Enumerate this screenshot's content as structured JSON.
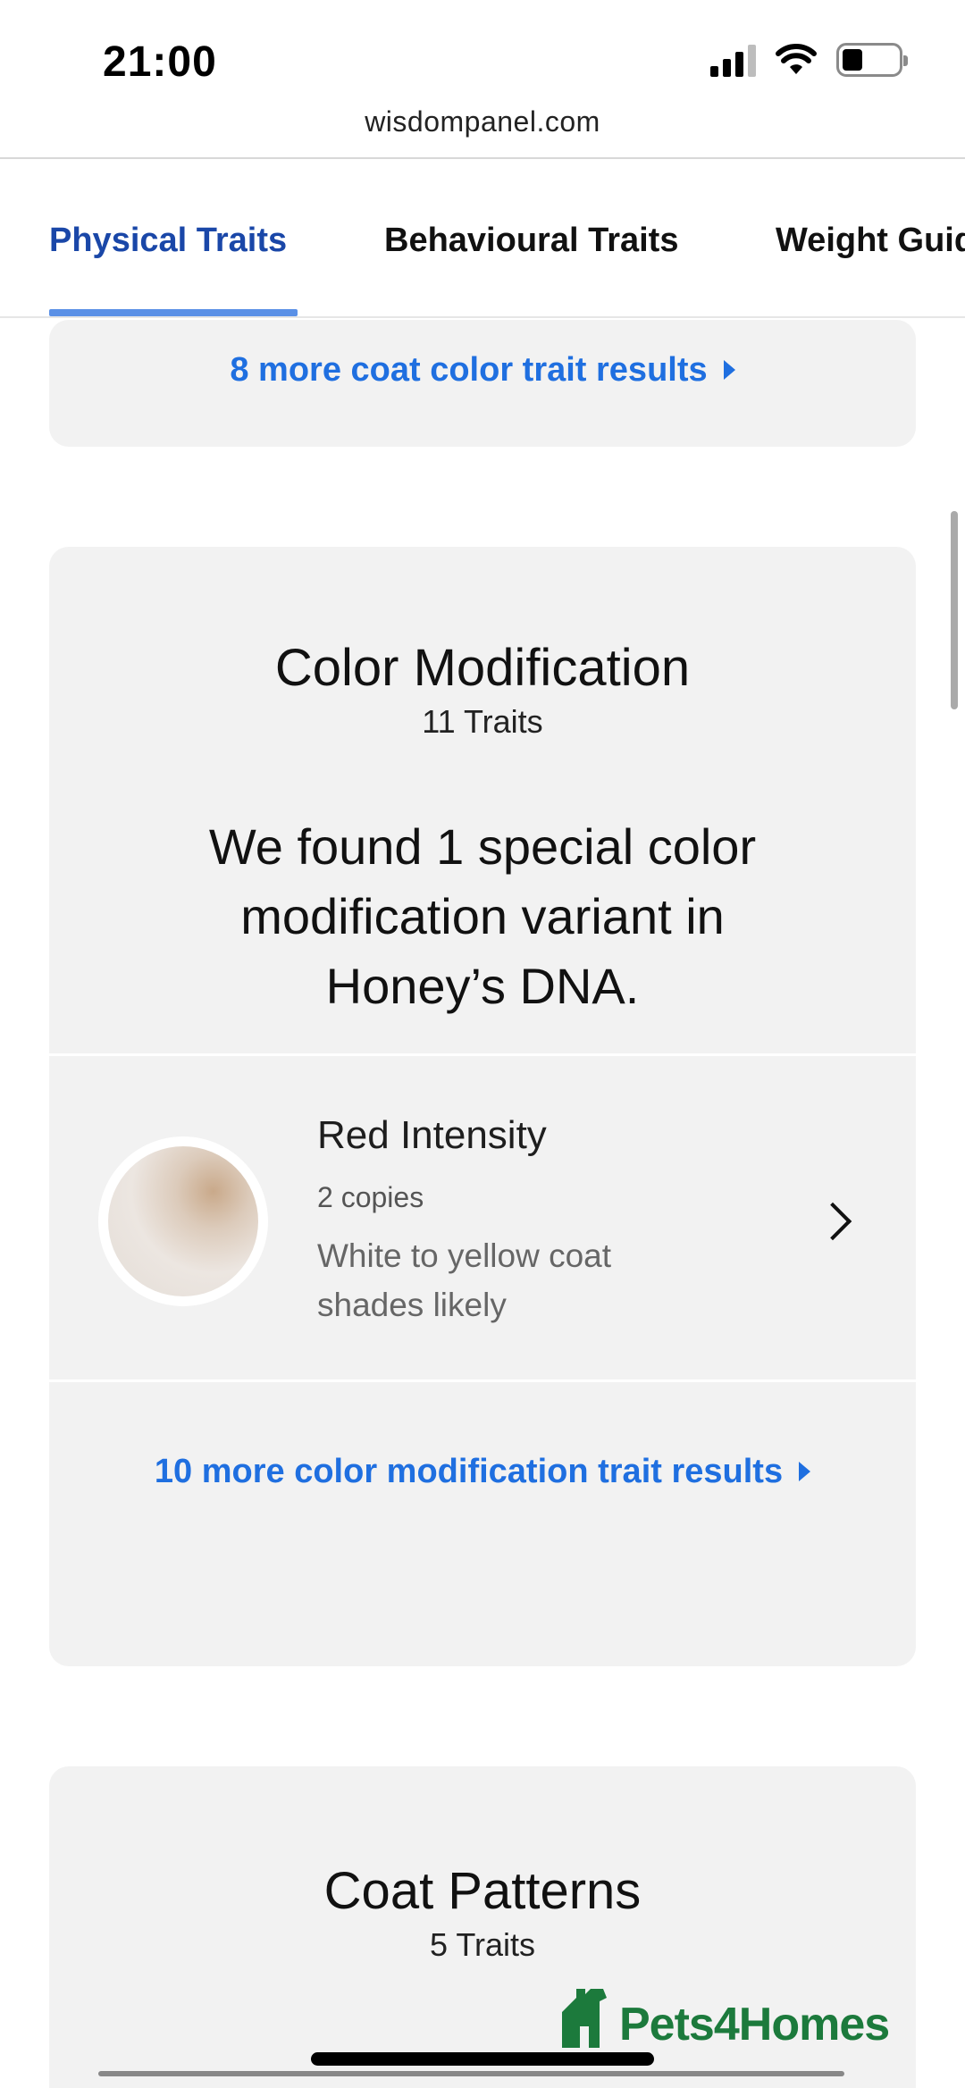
{
  "status_bar": {
    "time": "21:00"
  },
  "browser": {
    "url": "wisdompanel.com"
  },
  "tabs": [
    {
      "label": "Physical Traits",
      "active": true
    },
    {
      "label": "Behavioural Traits",
      "active": false
    },
    {
      "label": "Weight Guide",
      "active": false
    }
  ],
  "coat_color_card": {
    "more_link": "8 more coat color trait results"
  },
  "color_mod_card": {
    "title": "Color Modification",
    "subtitle": "11 Traits",
    "summary": "We found 1 special color modification variant in Honey’s DNA.",
    "trait": {
      "name": "Red Intensity",
      "copies": "2 copies",
      "description": "White to yellow coat shades likely"
    },
    "more_link": "10 more color modification trait results"
  },
  "coat_patterns_card": {
    "title": "Coat Patterns",
    "subtitle": "5 Traits"
  },
  "watermark": {
    "text": "Pets4Homes"
  },
  "colors": {
    "accent": "#1f6fe0",
    "active_tab": "#1a47a8",
    "tab_underline": "#5a90e6",
    "card_bg": "#f2f2f2",
    "logo_green": "#1c7a3c"
  }
}
